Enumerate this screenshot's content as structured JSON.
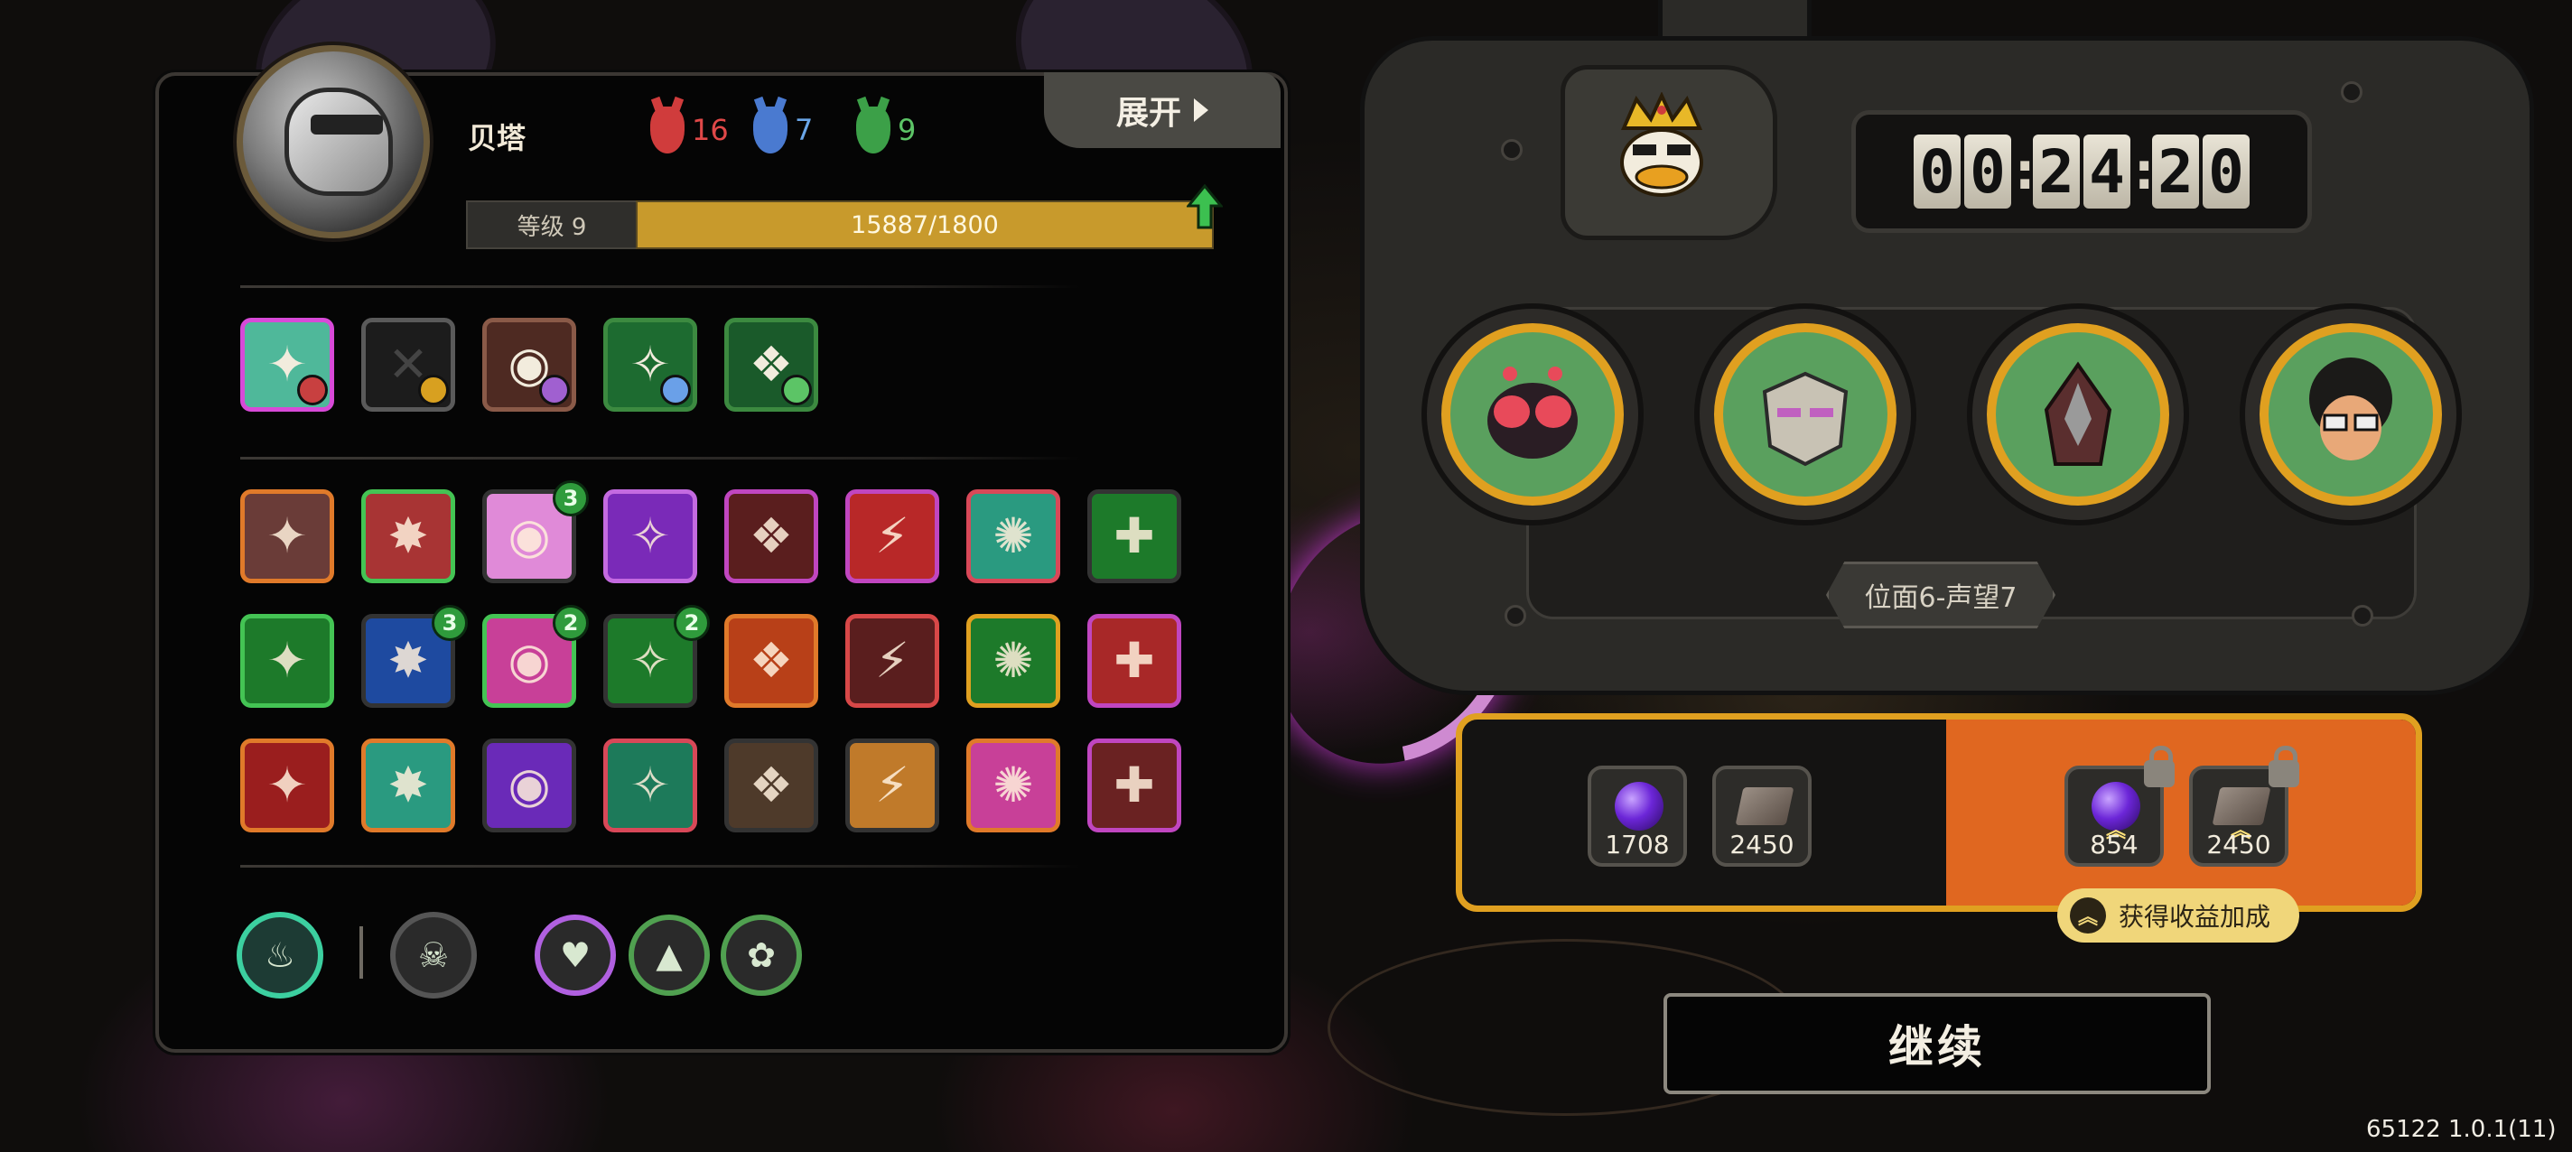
{
  "character": {
    "name": "贝塔",
    "level_label": "等级 9",
    "xp_text": "15887/1800",
    "xp_progress": 1.0,
    "stats": [
      {
        "icon": "red-mask-icon",
        "value": "16",
        "color": "#e04848"
      },
      {
        "icon": "blue-mask-icon",
        "value": "7",
        "color": "#6aa6e8"
      },
      {
        "icon": "green-mask-icon",
        "value": "9",
        "color": "#5cc466"
      }
    ]
  },
  "expand_label": "展开",
  "equipment": [
    {
      "icon": "crosshair-rune-icon",
      "border": "#d84ad8",
      "bg": "#4fb89a",
      "corner": "#c84040"
    },
    {
      "icon": "empty-slot-icon",
      "border": "#5a5a5a",
      "bg": "#1c1c1c",
      "corner": "#d8a020"
    },
    {
      "icon": "eye-target-icon",
      "border": "#8a5a48",
      "bg": "#4e2a22",
      "corner": "#a060d0"
    },
    {
      "icon": "green-spire-icon",
      "border": "#3c8a40",
      "bg": "#1d6b30",
      "corner": "#6aa0e8"
    },
    {
      "icon": "green-spikes-icon",
      "border": "#3c8a40",
      "bg": "#1a5a2a",
      "corner": "#5cc466"
    }
  ],
  "skills": [
    [
      {
        "icon": "gear-rune-icon",
        "border": "#e07a2a",
        "bg": "#6a3c38",
        "badge": ""
      },
      {
        "icon": "red-claws-icon",
        "border": "#44c454",
        "bg": "#a83434",
        "badge": ""
      },
      {
        "icon": "pink-eye-icon",
        "border": "#333",
        "bg": "#e08ad8",
        "badge": "3"
      },
      {
        "icon": "purple-drip-icon",
        "border": "#c46ae0",
        "bg": "#7a2ab8",
        "badge": ""
      },
      {
        "icon": "crossed-swords-icon",
        "border": "#c046c0",
        "bg": "#5a1e1e",
        "badge": ""
      },
      {
        "icon": "lightning-slash-icon",
        "border": "#c046c0",
        "bg": "#b82828",
        "badge": ""
      },
      {
        "icon": "teal-swirl-icon",
        "border": "#d84858",
        "bg": "#2a9a80",
        "badge": ""
      },
      {
        "icon": "green-v-icon",
        "border": "#333",
        "bg": "#1d7a2a",
        "badge": ""
      }
    ],
    [
      {
        "icon": "red-arrow-icon",
        "border": "#44c454",
        "bg": "#1d7a2a",
        "badge": ""
      },
      {
        "icon": "blue-lightning-icon",
        "border": "#333",
        "bg": "#1e4aa0",
        "badge": "3"
      },
      {
        "icon": "pink-gear-icon",
        "border": "#44c454",
        "bg": "#c84098",
        "badge": "2"
      },
      {
        "icon": "golden-trident-icon",
        "border": "#333",
        "bg": "#1d7a2a",
        "badge": "2"
      },
      {
        "icon": "flame-face-icon",
        "border": "#e07a2a",
        "bg": "#b84018",
        "badge": ""
      },
      {
        "icon": "twin-blades-icon",
        "border": "#d84848",
        "bg": "#5a1e1e",
        "badge": ""
      },
      {
        "icon": "green-wave-icon",
        "border": "#e0a020",
        "bg": "#1d7a2a",
        "badge": ""
      },
      {
        "icon": "red-figure-icon",
        "border": "#c046c0",
        "bg": "#a82828",
        "badge": ""
      }
    ],
    [
      {
        "icon": "red-fang-icon",
        "border": "#e07a2a",
        "bg": "#9a1e1e",
        "badge": ""
      },
      {
        "icon": "spike-trap-icon",
        "border": "#e07a2a",
        "bg": "#2a9a80",
        "badge": ""
      },
      {
        "icon": "purple-shard-icon",
        "border": "#333",
        "bg": "#6a2ab8",
        "badge": ""
      },
      {
        "icon": "green-spears-icon",
        "border": "#d84858",
        "bg": "#1d7a5a",
        "badge": ""
      },
      {
        "icon": "golden-cog-icon",
        "border": "#333",
        "bg": "#4e3a2a",
        "badge": ""
      },
      {
        "icon": "chain-blade-icon",
        "border": "#333",
        "bg": "#c07a2a",
        "badge": ""
      },
      {
        "icon": "white-beast-icon",
        "border": "#e07a2a",
        "bg": "#c84098",
        "badge": ""
      },
      {
        "icon": "stone-pillar-icon",
        "border": "#c046c0",
        "bg": "#6a2222",
        "badge": ""
      }
    ]
  ],
  "bottom_icons": [
    {
      "icon": "green-flame-icon",
      "ring": "#3cd0a0",
      "bg": "#1d3b34"
    },
    {
      "icon": "skull-emblem-icon",
      "ring": "#555",
      "bg": "#2a2a2a"
    },
    {
      "icon": "heart-token-icon",
      "ring": "#b060e0",
      "bg": "#2a2a2a"
    },
    {
      "icon": "triangle-token-icon",
      "ring": "#50a050",
      "bg": "#2a2a2a"
    },
    {
      "icon": "drops-token-icon",
      "ring": "#50a050",
      "bg": "#2a2a2a"
    }
  ],
  "timer": {
    "digits": [
      "0",
      "0",
      "2",
      "4",
      "2",
      "0"
    ]
  },
  "team": [
    {
      "icon": "red-mite-hero-icon"
    },
    {
      "icon": "armored-golem-hero-icon"
    },
    {
      "icon": "hooded-raven-hero-icon"
    },
    {
      "icon": "curly-hair-glasses-hero-icon"
    }
  ],
  "stage_label": "位面6-声望7",
  "rewards": {
    "base": [
      {
        "icon": "purple-orb-icon",
        "value": "1708"
      },
      {
        "icon": "leather-book-icon",
        "value": "2450"
      }
    ],
    "bonus": [
      {
        "icon": "purple-orb-icon",
        "value": "854"
      },
      {
        "icon": "leather-book-icon",
        "value": "2450"
      }
    ],
    "bonus_label": "获得收益加成"
  },
  "continue_label": "继续",
  "version": "65122 1.0.1(11)",
  "colors": {
    "gold": "#e0a020",
    "orange": "#e06720",
    "xp": "#c89a2c"
  }
}
